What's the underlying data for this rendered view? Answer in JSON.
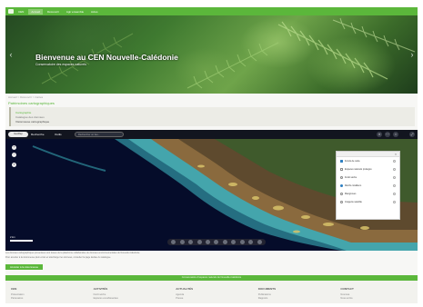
{
  "nav": {
    "items": [
      {
        "label": "CEN"
      },
      {
        "label": "Accueil"
      },
      {
        "label": "Découvrir"
      },
      {
        "label": "Agir ensemble"
      },
      {
        "label": "Actus"
      }
    ],
    "active_index": 1
  },
  "banner": {
    "title": "Bienvenue au CEN Nouvelle-Calédonie",
    "subtitle": "Conservatoire des espaces naturels"
  },
  "breadcrumb": "Accueil > Découvrir > Cartes",
  "page_heading": "Patrimoines cartographiques",
  "info_box": {
    "line1": "Cartographie",
    "line2": "Catalogue des données",
    "line3": "Visionneuse cartographique"
  },
  "map": {
    "logo": "GeoRep",
    "toolbar": {
      "btn1": "Recherche",
      "btn2": "Outils",
      "search_placeholder": "Rechercher un lieu..."
    },
    "zoom": {
      "in": "+",
      "out": "−"
    },
    "layers": {
      "items": [
        {
          "label": "Fonds de carte",
          "type": "checkbox",
          "checked": true
        },
        {
          "label": "Espaces naturels protégés",
          "type": "checkbox",
          "checked": false
        },
        {
          "label": "Forêt sèche",
          "type": "radio",
          "checked": false
        },
        {
          "label": "Récifs coralliens",
          "type": "radio",
          "checked": true
        },
        {
          "label": "Mangroves",
          "type": "radio",
          "checked": false
        },
        {
          "label": "Imagerie satellite",
          "type": "radio",
          "checked": false
        }
      ]
    },
    "scale_label": "2 km"
  },
  "map_attribution": {
    "line1": "Les données cartographiques présentées sont issues de la plateforme collaborative de données environnementales de Nouvelle-Calédonie.",
    "line2": "Pour accéder à la visionneuse plein écran et télécharger les données, consultez la page dédiée du catalogue."
  },
  "button_fullscreen": "Accéder à la visionneuse",
  "footer_bar": "Conservatoire d'espaces naturels de Nouvelle-Calédonie",
  "footer": {
    "columns": [
      {
        "heading": "CEN",
        "links": [
          "Présentation",
          "Partenaires"
        ]
      },
      {
        "heading": "ACTIVITÉS",
        "links": [
          "Forêt sèche",
          "Espèces envahissantes"
        ]
      },
      {
        "heading": "ACTUALITÉS",
        "links": [
          "Agenda",
          "Presse"
        ]
      },
      {
        "heading": "DOCUMENTS",
        "links": [
          "Publications",
          "Rapports"
        ]
      },
      {
        "heading": "CONTACT",
        "links": [
          "Nouméa",
          "Nous écrire"
        ]
      }
    ]
  },
  "colors": {
    "accent": "#5bb73b",
    "map_deep": "#050c2a",
    "lagoon": "#3fc0c8"
  }
}
